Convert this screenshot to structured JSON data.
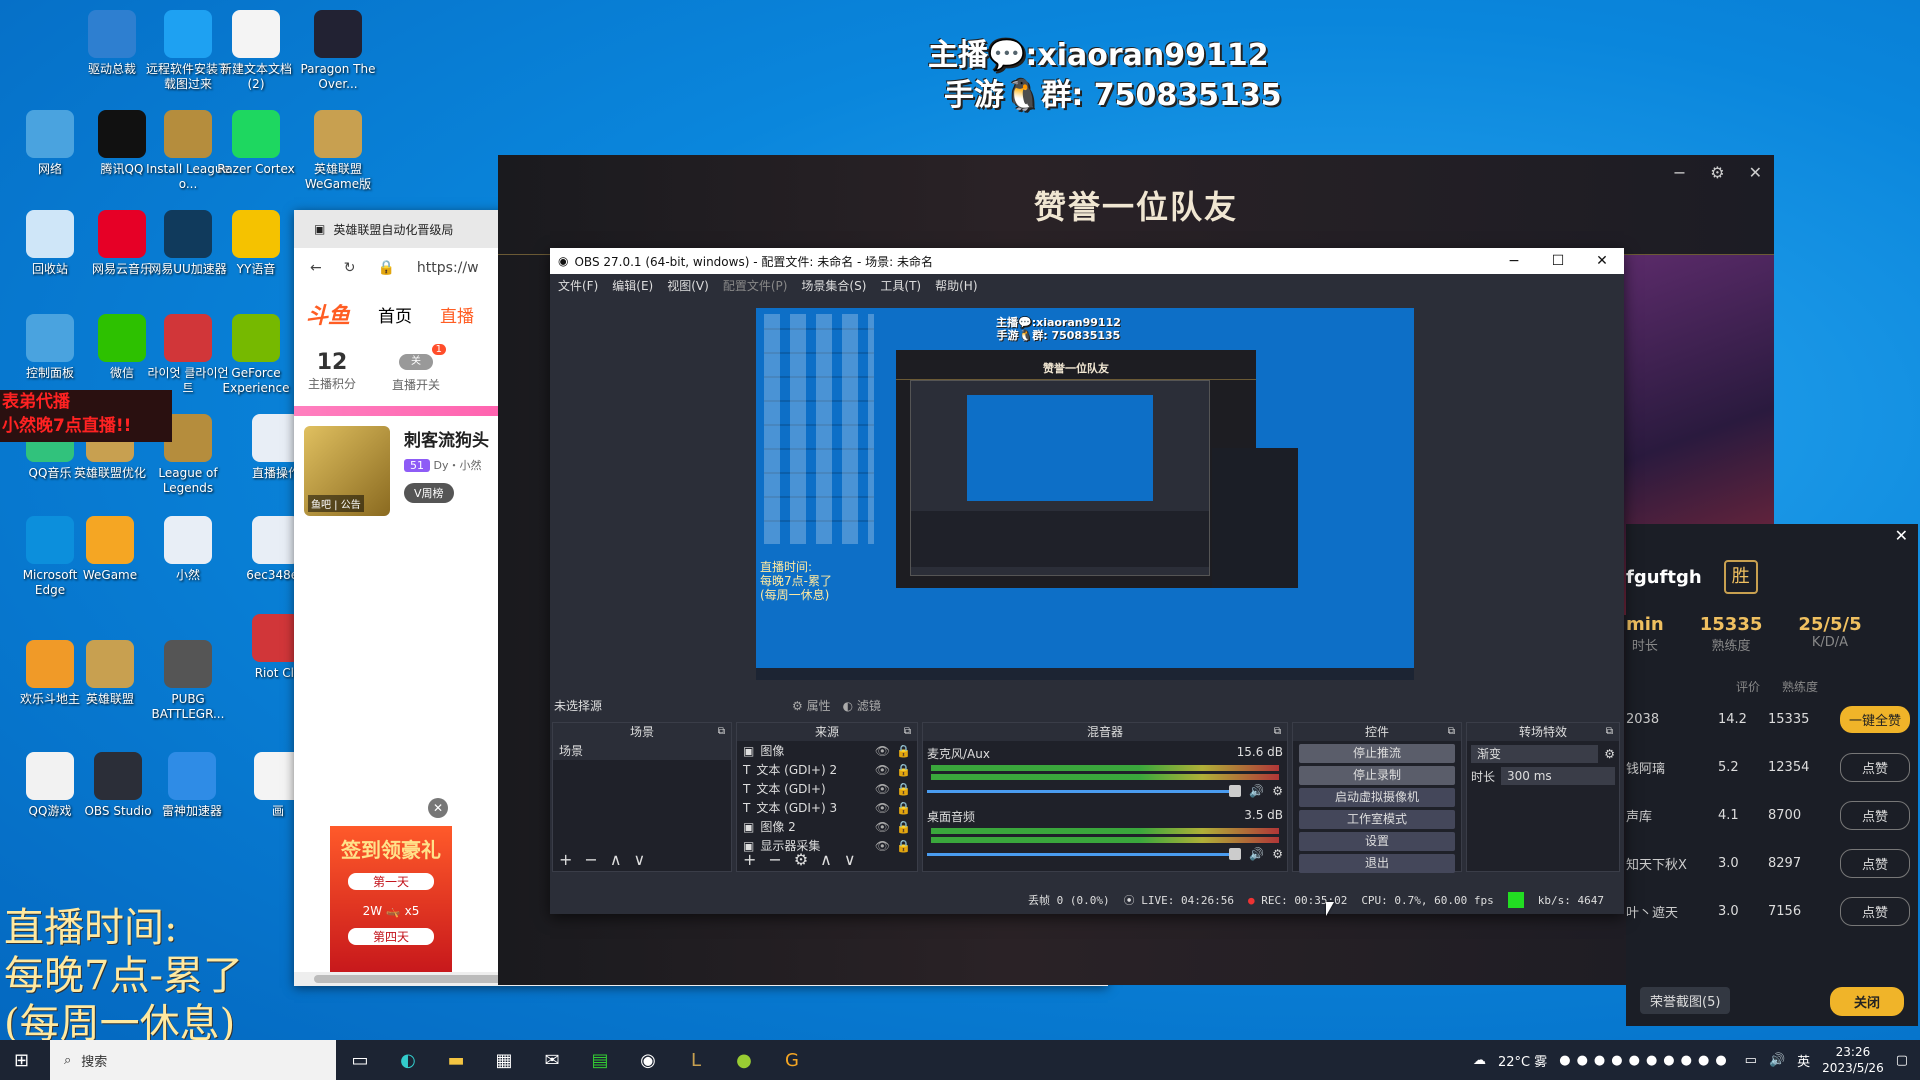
{
  "overlay": {
    "line1": "主播💬:xiaoran99112",
    "line2": "手游🐧群: 750835135"
  },
  "desktop_icons": [
    {
      "label": "驱动总裁",
      "icon": "driver-icon",
      "color": "#2e7fd0"
    },
    {
      "label": "远程软件安装下载图过来",
      "icon": "remote-icon",
      "color": "#1ea1f2"
    },
    {
      "label": "新建文本文档 (2)",
      "icon": "text-doc-icon",
      "color": "#f4f4f4"
    },
    {
      "label": "Paragon The Over...",
      "icon": "paragon-icon",
      "color": "#223"
    },
    {
      "label": "网络",
      "icon": "network-icon",
      "color": "#4aa3df"
    },
    {
      "label": "腾讯QQ",
      "icon": "qq-icon",
      "color": "#111"
    },
    {
      "label": "Install League o...",
      "icon": "league-install-icon",
      "color": "#b58d3d"
    },
    {
      "label": "Razer Cortex",
      "icon": "razer-icon",
      "color": "#1ed760"
    },
    {
      "label": "英雄联盟 WeGame版",
      "icon": "lol-wegame-icon",
      "color": "#c8a050"
    },
    {
      "label": "回收站",
      "icon": "recycle-bin-icon",
      "color": "#cfe6f8"
    },
    {
      "label": "网易云音乐",
      "icon": "netease-music-icon",
      "color": "#e60026"
    },
    {
      "label": "网易UU加速器",
      "icon": "uu-icon",
      "color": "#103a5c"
    },
    {
      "label": "YY语音",
      "icon": "yy-icon",
      "color": "#f5c200"
    },
    {
      "label": "控制面板",
      "icon": "control-panel-icon",
      "color": "#4aa3df"
    },
    {
      "label": "微信",
      "icon": "wechat-icon",
      "color": "#2dc100"
    },
    {
      "label": "라이엇 클라이언트",
      "icon": "riot-icon",
      "color": "#d13639"
    },
    {
      "label": "GeForce Experience",
      "icon": "geforce-icon",
      "color": "#76b900"
    },
    {
      "label": "QQ音乐",
      "icon": "qq-music-icon",
      "color": "#31c27c"
    },
    {
      "label": "英雄联盟优化",
      "icon": "lol-opt-icon",
      "color": "#c8a050"
    },
    {
      "label": "League of Legends",
      "icon": "lol-icon",
      "color": "#b58d3d"
    },
    {
      "label": "直播操作",
      "icon": "image-file-icon",
      "color": "#e8eef6"
    },
    {
      "label": "Microsoft Edge",
      "icon": "edge-icon",
      "color": "#0c8fdc"
    },
    {
      "label": "WeGame",
      "icon": "wegame-icon",
      "color": "#f5a623"
    },
    {
      "label": "小然",
      "icon": "image-file-icon",
      "color": "#e8eef6"
    },
    {
      "label": "6ec348e1",
      "icon": "image-file-icon",
      "color": "#e8eef6"
    },
    {
      "label": "欢乐斗地主",
      "icon": "ddz-icon",
      "color": "#f09a28"
    },
    {
      "label": "英雄联盟",
      "icon": "lol-client-icon",
      "color": "#c8a050"
    },
    {
      "label": "PUBG BATTLEGR...",
      "icon": "pubg-icon",
      "color": "#555"
    },
    {
      "label": "Riot Cli",
      "icon": "riot-icon",
      "color": "#d13639"
    },
    {
      "label": "QQ游戏",
      "icon": "qq-game-icon",
      "color": "#f2f2f2"
    },
    {
      "label": "OBS Studio",
      "icon": "obs-icon",
      "color": "#2b2e38"
    },
    {
      "label": "雷神加速器",
      "icon": "leishen-icon",
      "color": "#2f8ce6"
    },
    {
      "label": "画",
      "icon": "doc-icon",
      "color": "#f4f4f4"
    }
  ],
  "red_banner": {
    "line1": "表弟代播",
    "line2": "小然晚7点直播!!"
  },
  "schedule": {
    "line1": "直播时间:",
    "line2": "每晚7点-累了",
    "line3": "(每周一休息)"
  },
  "browser": {
    "tab_title": "英雄联盟自动化晋级局",
    "url": "https://w",
    "logo": "斗鱼",
    "nav": [
      "首页",
      "直播"
    ],
    "points_value": "12",
    "points_label": "主播积分",
    "switch_label": "直播开关",
    "switch_state": "关",
    "badge": "1",
    "streamer_name": "刺客流狗头",
    "level": "51",
    "sub": "Dy・小然",
    "tag1": "鱼吧",
    "tag2": "公告",
    "vweek": "V周榜",
    "promo_title": "签到领豪礼",
    "promo_items": [
      "第一天",
      "2W",
      "x5",
      "第四天"
    ]
  },
  "game": {
    "header": "赞誉一位队友",
    "controls": [
      "−",
      "⚙",
      "✕"
    ]
  },
  "stats": {
    "player": "fguftgh",
    "result": "胜",
    "time_label": "时长",
    "time_val": "min",
    "mastery_label": "熟练度",
    "mastery_val": "15335",
    "kda_label": "K/D/A",
    "kda_val": "25/5/5",
    "col_score": "评价",
    "col_mastery": "熟练度",
    "rows": [
      {
        "name": "2038",
        "score": "14.2",
        "mastery": "15335",
        "btn": "一键全赞"
      },
      {
        "name": "钱阿璃",
        "score": "5.2",
        "mastery": "12354",
        "btn": "点赞"
      },
      {
        "name": "声库",
        "score": "4.1",
        "mastery": "8700",
        "btn": "点赞"
      },
      {
        "name": "知天下秋X",
        "score": "3.0",
        "mastery": "8297",
        "btn": "点赞"
      },
      {
        "name": "叶丶遮天",
        "score": "3.0",
        "mastery": "7156",
        "btn": "点赞"
      }
    ],
    "screenshot_btn": "荣誉截图(5)",
    "close_btn": "关闭"
  },
  "obs": {
    "title": "OBS 27.0.1 (64-bit, windows) - 配置文件: 未命名 - 场景: 未命名",
    "menus": [
      "文件(F)",
      "编辑(E)",
      "视图(V)",
      "配置文件(P)",
      "场景集合(S)",
      "工具(T)",
      "帮助(H)"
    ],
    "no_source": "未选择源",
    "props": "属性",
    "filters": "滤镜",
    "preview_line1": "主播💬:xiaoran99112",
    "preview_line2": "手游🐧群: 750835135",
    "preview_game": "赞誉一位队友",
    "preview_schedule1": "直播时间:",
    "preview_schedule2": "每晚7点-累了",
    "preview_schedule3": "(每周一休息)",
    "docks": {
      "scenes": "场景",
      "sources": "来源",
      "mixer": "混音器",
      "controls": "控件",
      "transitions": "转场特效"
    },
    "scene_item": "场景",
    "sources": [
      "图像",
      "文本 (GDI+) 2",
      "文本 (GDI+)",
      "文本 (GDI+) 3",
      "图像 2",
      "显示器采集"
    ],
    "mixer": [
      {
        "name": "麦克风/Aux",
        "db": "15.6 dB"
      },
      {
        "name": "桌面音频",
        "db": "3.5 dB"
      }
    ],
    "control_buttons": [
      "停止推流",
      "停止录制",
      "启动虚拟摄像机",
      "工作室模式",
      "设置",
      "退出"
    ],
    "transition": "渐变",
    "duration_label": "时长",
    "duration_val": "300 ms",
    "status": {
      "dropped": "丢帧 0 (0.0%)",
      "live": "LIVE: 04:26:56",
      "rec": "REC: 00:35:02",
      "cpu": "CPU: 0.7%, 60.00 fps",
      "kbps": "kb/s: 4647"
    }
  },
  "taskbar": {
    "search": "搜索",
    "weather": "22°C 雾",
    "ime": "英",
    "time": "23:26",
    "date": "2023/5/26"
  },
  "colors": {
    "obs_bg": "#2b2e38",
    "accent_gold": "#f0b429",
    "live_green": "#22dd22"
  }
}
